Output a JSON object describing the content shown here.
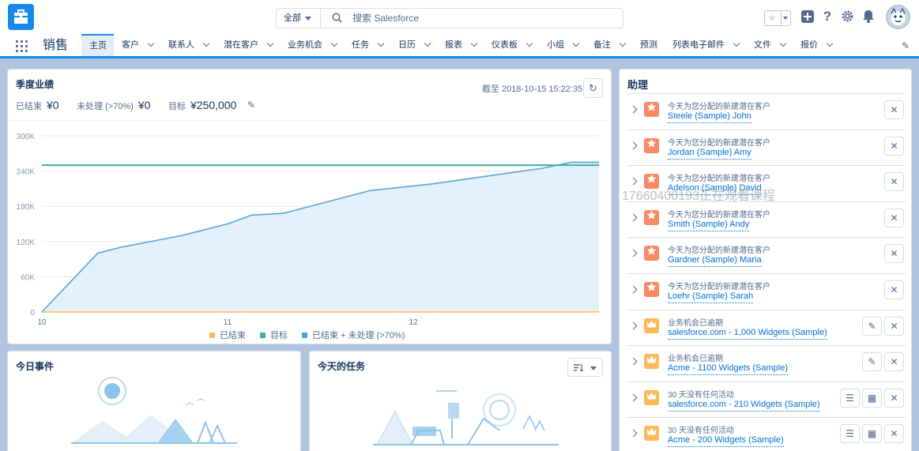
{
  "global": {
    "search_scope": "全部",
    "search_placeholder": "搜索 Salesforce"
  },
  "nav": {
    "app_name": "销售",
    "items": [
      {
        "label": "主页",
        "chevron": false,
        "active": true
      },
      {
        "label": "客户",
        "chevron": true
      },
      {
        "label": "联系人",
        "chevron": true
      },
      {
        "label": "潜在客户",
        "chevron": true
      },
      {
        "label": "业务机会",
        "chevron": true
      },
      {
        "label": "任务",
        "chevron": true
      },
      {
        "label": "日历",
        "chevron": true
      },
      {
        "label": "报表",
        "chevron": true
      },
      {
        "label": "仪表板",
        "chevron": true
      },
      {
        "label": "小组",
        "chevron": true
      },
      {
        "label": "备注",
        "chevron": true
      },
      {
        "label": "预测",
        "chevron": false
      },
      {
        "label": "列表电子邮件",
        "chevron": true
      },
      {
        "label": "文件",
        "chevron": true
      },
      {
        "label": "报价",
        "chevron": true
      }
    ]
  },
  "performance": {
    "title": "季度业绩",
    "as_of": "截至 2018-10-15 15:22:35",
    "closed_label": "已结束",
    "closed_value": "¥0",
    "open_label": "未处理 (>70%)",
    "open_value": "¥0",
    "goal_label": "目标",
    "goal_value": "¥250,000"
  },
  "chart_data": {
    "type": "line",
    "x_ticks": [
      "10",
      "11",
      "12"
    ],
    "y_ticks": [
      "0",
      "60K",
      "120K",
      "180K",
      "240K",
      "300K"
    ],
    "ylim": [
      0,
      300000
    ],
    "xlim": [
      0,
      3
    ],
    "series": [
      {
        "name": "已结束",
        "color": "#ffb75d",
        "x": [
          0,
          3
        ],
        "values": [
          0,
          0
        ]
      },
      {
        "name": "目标",
        "color": "#3bb29a",
        "x": [
          0,
          3
        ],
        "values": [
          250000,
          250000
        ]
      },
      {
        "name": "已结束 + 未处理 (>70%)",
        "color": "#52a5d9",
        "x": [
          0,
          0.3,
          0.42,
          0.75,
          1.0,
          1.13,
          1.3,
          1.77,
          2.1,
          2.7,
          2.85,
          3.0
        ],
        "values": [
          0,
          100000,
          110000,
          130000,
          150000,
          165000,
          168000,
          207000,
          218000,
          245000,
          255000,
          255000
        ]
      }
    ],
    "legend": [
      "已结束",
      "目标",
      "已结束 + 未处理 (>70%)"
    ],
    "legend_position": "bottom",
    "grid": true
  },
  "events": {
    "title": "今日事件"
  },
  "tasks": {
    "title": "今天的任务"
  },
  "assistant": {
    "title": "助理",
    "items": [
      {
        "kind": "lead",
        "subtitle": "今天为您分配的新建潜在客户",
        "link": "Steele (Sample) John",
        "buttons": [
          "close"
        ]
      },
      {
        "kind": "lead",
        "subtitle": "今天为您分配的新建潜在客户",
        "link": "Jordan (Sample) Amy",
        "buttons": [
          "close"
        ]
      },
      {
        "kind": "lead",
        "subtitle": "今天为您分配的新建潜在客户",
        "link": "Adelson (Sample) David",
        "buttons": [
          "close"
        ]
      },
      {
        "kind": "lead",
        "subtitle": "今天为您分配的新建潜在客户",
        "link": "Smith (Sample) Andy",
        "buttons": [
          "close"
        ]
      },
      {
        "kind": "lead",
        "subtitle": "今天为您分配的新建潜在客户",
        "link": "Gardner (Sample) Maria",
        "buttons": [
          "close"
        ]
      },
      {
        "kind": "lead",
        "subtitle": "今天为您分配的新建潜在客户",
        "link": "Loehr (Sample) Sarah",
        "buttons": [
          "close"
        ]
      },
      {
        "kind": "opp",
        "subtitle": "业务机会已逾期",
        "link": "salesforce.com - 1,000 Widgets (Sample)",
        "buttons": [
          "edit",
          "close"
        ]
      },
      {
        "kind": "opp",
        "subtitle": "业务机会已逾期",
        "link": "Acme - 1100 Widgets (Sample)",
        "buttons": [
          "edit",
          "close"
        ]
      },
      {
        "kind": "opp",
        "subtitle": "30 天没有任何活动",
        "link": "salesforce.com - 210 Widgets (Sample)",
        "buttons": [
          "task",
          "event",
          "close"
        ]
      },
      {
        "kind": "opp",
        "subtitle": "30 天没有任何活动",
        "link": "Acme - 200 Widgets (Sample)",
        "buttons": [
          "task",
          "event",
          "close"
        ]
      }
    ]
  },
  "watermark": "17660400193正在观看课程",
  "colors": {
    "brand": "#1589ee",
    "lead_icon": "#f88962",
    "opp_icon": "#fcb95b",
    "link": "#0070d2"
  }
}
